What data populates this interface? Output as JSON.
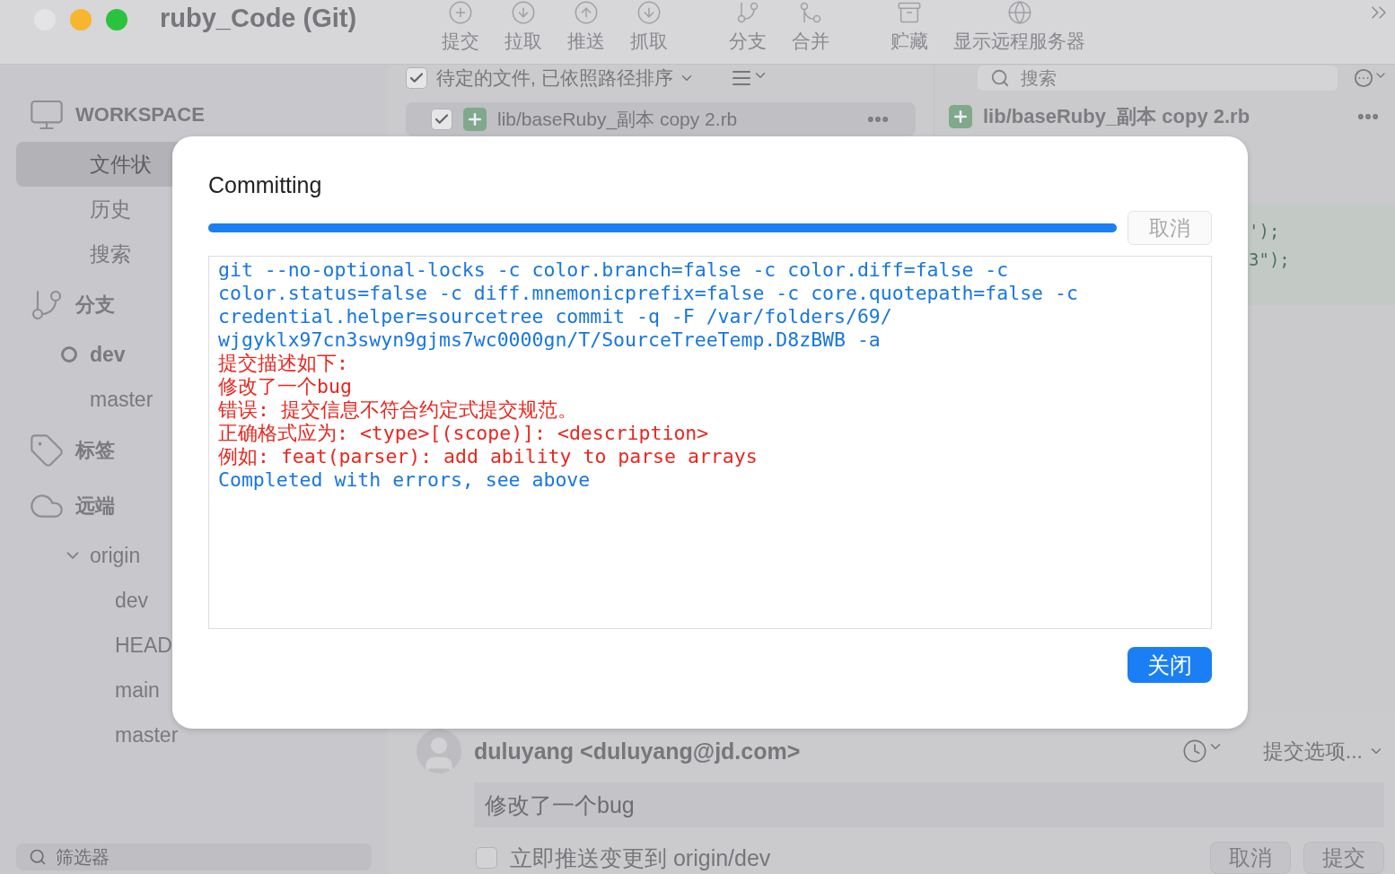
{
  "window": {
    "title": "ruby_Code (Git)"
  },
  "toolbar": {
    "items": [
      {
        "label": "提交"
      },
      {
        "label": "拉取"
      },
      {
        "label": "推送"
      },
      {
        "label": "抓取"
      },
      {
        "label": "分支"
      },
      {
        "label": "合并"
      },
      {
        "label": "贮藏"
      },
      {
        "label": "显示远程服务器"
      }
    ]
  },
  "filebar": {
    "show_pending": true,
    "sort_label": "待定的文件, 已依照路径排序",
    "search": {
      "placeholder": "搜索"
    }
  },
  "sidebar": {
    "sections": [
      {
        "title": "WORKSPACE",
        "kind": "workspace",
        "items": [
          {
            "label": "文件状",
            "selected": true
          },
          {
            "label": "历史",
            "selected": false
          },
          {
            "label": "搜索",
            "selected": false
          }
        ]
      },
      {
        "title": "分支",
        "kind": "branches",
        "items": [
          {
            "label": "dev",
            "selected": false,
            "current": true
          },
          {
            "label": "master",
            "selected": false,
            "current": false
          }
        ]
      },
      {
        "title": "标签",
        "kind": "tags"
      },
      {
        "title": "远端",
        "kind": "remotes",
        "items": [
          {
            "label": "origin",
            "selected": false,
            "expanded": true,
            "children": [
              {
                "label": "dev",
                "selected": false
              },
              {
                "label": "HEAD",
                "selected": false
              },
              {
                "label": "main",
                "selected": false
              },
              {
                "label": "master",
                "selected": false
              }
            ]
          }
        ]
      }
    ],
    "filter": {
      "placeholder": "筛选器"
    }
  },
  "files": [
    {
      "path": "lib/baseRuby_副本 copy 2.rb",
      "staged": true
    }
  ],
  "diff": {
    "file": "lib/baseRuby_副本 copy 2.rb",
    "lines": [
      "');",
      "3\");"
    ]
  },
  "commit": {
    "author": "duluyang <duluyang@jd.com>",
    "options": "提交选项...",
    "message": "修改了一个bug",
    "push_label": "立即推送变更到 origin/dev",
    "push_now": false,
    "buttons": [
      "取消",
      "提交"
    ]
  },
  "dialog": {
    "title": "Committing",
    "level": 1,
    "cancel": {
      "label": "取消",
      "disabled": true
    },
    "log": [
      {
        "kind": "command",
        "text": "git --no-optional-locks -c color.branch=false -c color.diff=false -c"
      },
      {
        "kind": "command",
        "text": "color.status=false -c diff.mnemonicprefix=false -c core.quotepath=false -c"
      },
      {
        "kind": "command",
        "text": "credential.helper=sourcetree commit -q -F /var/folders/69/"
      },
      {
        "kind": "command",
        "text": "wjgyklx97cn3swyn9gjms7wc0000gn/T/SourceTreeTemp.D8zBWB -a"
      },
      {
        "kind": "error",
        "text": "提交描述如下:"
      },
      {
        "kind": "error",
        "text": "修改了一个bug"
      },
      {
        "kind": "error",
        "text": "错误: 提交信息不符合约定式提交规范。"
      },
      {
        "kind": "error",
        "text": "正确格式应为: <type>[(scope)]: <description>"
      },
      {
        "kind": "error",
        "text": "例如: feat(parser): add ability to parse arrays"
      },
      {
        "kind": "command",
        "text": "Completed with errors, see above"
      }
    ],
    "close": "关闭"
  }
}
